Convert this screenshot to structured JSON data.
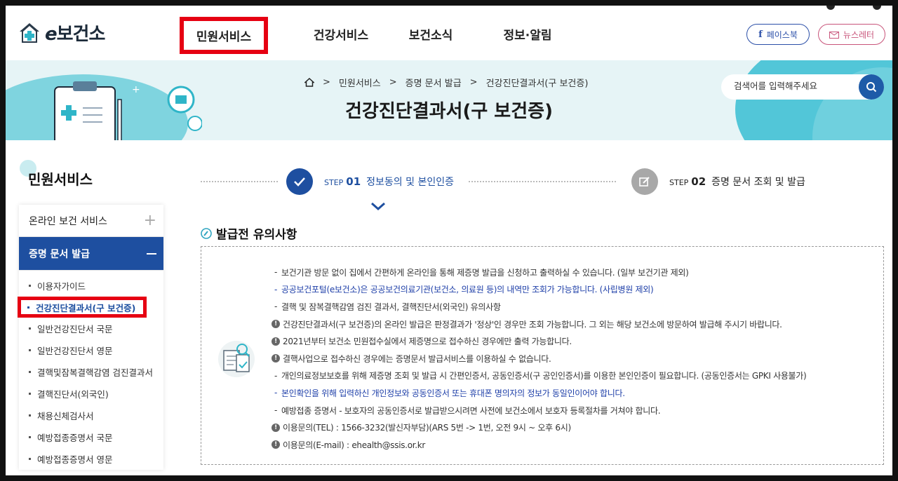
{
  "header": {
    "logo_text": "보건소",
    "logo_prefix": "e",
    "nav": [
      "민원서비스",
      "건강서비스",
      "보건소식",
      "정보·알림"
    ],
    "facebook_label": "페이스북",
    "newsletter_label": "뉴스레터"
  },
  "visual": {
    "breadcrumb": [
      "민원서비스",
      "증명 문서 발급",
      "건강진단결과서(구 보건증)"
    ],
    "page_title": "건강진단결과서(구 보건증)",
    "search_placeholder": "검색어를 입력해주세요"
  },
  "sidebar": {
    "title": "민원서비스",
    "menus": [
      {
        "label": "온라인 보건 서비스"
      },
      {
        "label": "증명 문서 발급"
      }
    ],
    "sub_items": [
      "이용자가이드",
      "건강진단결과서(구 보건증)",
      "일반건강진단서 국문",
      "일반건강진단서 영문",
      "결핵및잠복결핵감염 검진결과서",
      "결핵진단서(외국인)",
      "채용신체검사서",
      "예방접종증명서 국문",
      "예방접종증명서 영문"
    ]
  },
  "steps": [
    {
      "tag": "STEP",
      "num": "01",
      "label": "정보동의 및 본인인증"
    },
    {
      "tag": "STEP",
      "num": "02",
      "label": "증명 문서 조회 및 발급"
    }
  ],
  "notice": {
    "title": "발급전 유의사항",
    "items": [
      {
        "type": "dash",
        "text": "보건기관 방문 없이 집에서 간편하게 온라인을 통해 제증명 발급을 신청하고 출력하실 수 있습니다. (일부 보건기관 제외)"
      },
      {
        "type": "dash-blue",
        "text": "공공보건포털(e보건소)은 공공보건의료기관(보건소, 의료원 등)의 내역만 조회가 가능합니다. (사립병원 제외)"
      },
      {
        "type": "dash",
        "text": "결핵 및 잠복결핵감염 검진 결과서, 결핵진단서(외국인) 유의사항"
      },
      {
        "type": "warn",
        "text": "건강진단결과서(구 보건증)의 온라인 발급은 판정결과가 '정상'인 경우만 조회 가능합니다. 그 외는 해당 보건소에 방문하여 발급해 주시기 바랍니다."
      },
      {
        "type": "warn",
        "text": "2021년부터 보건소 민원접수실에서 제증명으로 접수하신 경우에만 출력 가능합니다."
      },
      {
        "type": "warn",
        "text": "결핵사업으로 접수하신 경우에는 증명문서 발급서비스를 이용하실 수 없습니다."
      },
      {
        "type": "dash",
        "text": "개인의료정보보호를 위해 제증명 조회 및 발급 시 간편인증서, 공동인증서(구 공인인증서)를 이용한 본인인증이 필요합니다. (공동인증서는 GPKI 사용불가)"
      },
      {
        "type": "dash-blue",
        "text": "본인확인을 위해 입력하신 개인정보와 공동인증서 또는 휴대폰 명의자의 정보가 동일인이어야 합니다."
      },
      {
        "type": "dash",
        "text": "예방접종 증명서 - 보호자의 공동인증서로 발급받으시려면 사전에 보건소에서 보호자 등록절차를 거쳐야 합니다."
      },
      {
        "type": "warn",
        "text": "이용문의(TEL) : 1566-3232(발신자부담)(ARS 5번 -> 1번, 오전 9시 ~ 오후 6시)"
      },
      {
        "type": "warn",
        "text": "이용문의(E-mail) : ehealth@ssis.or.kr"
      }
    ]
  },
  "colors": {
    "primary": "#1e4fa0",
    "highlight": "#e60012",
    "visual_bg": "#e6f4f6",
    "teal": "#52c6d8"
  }
}
